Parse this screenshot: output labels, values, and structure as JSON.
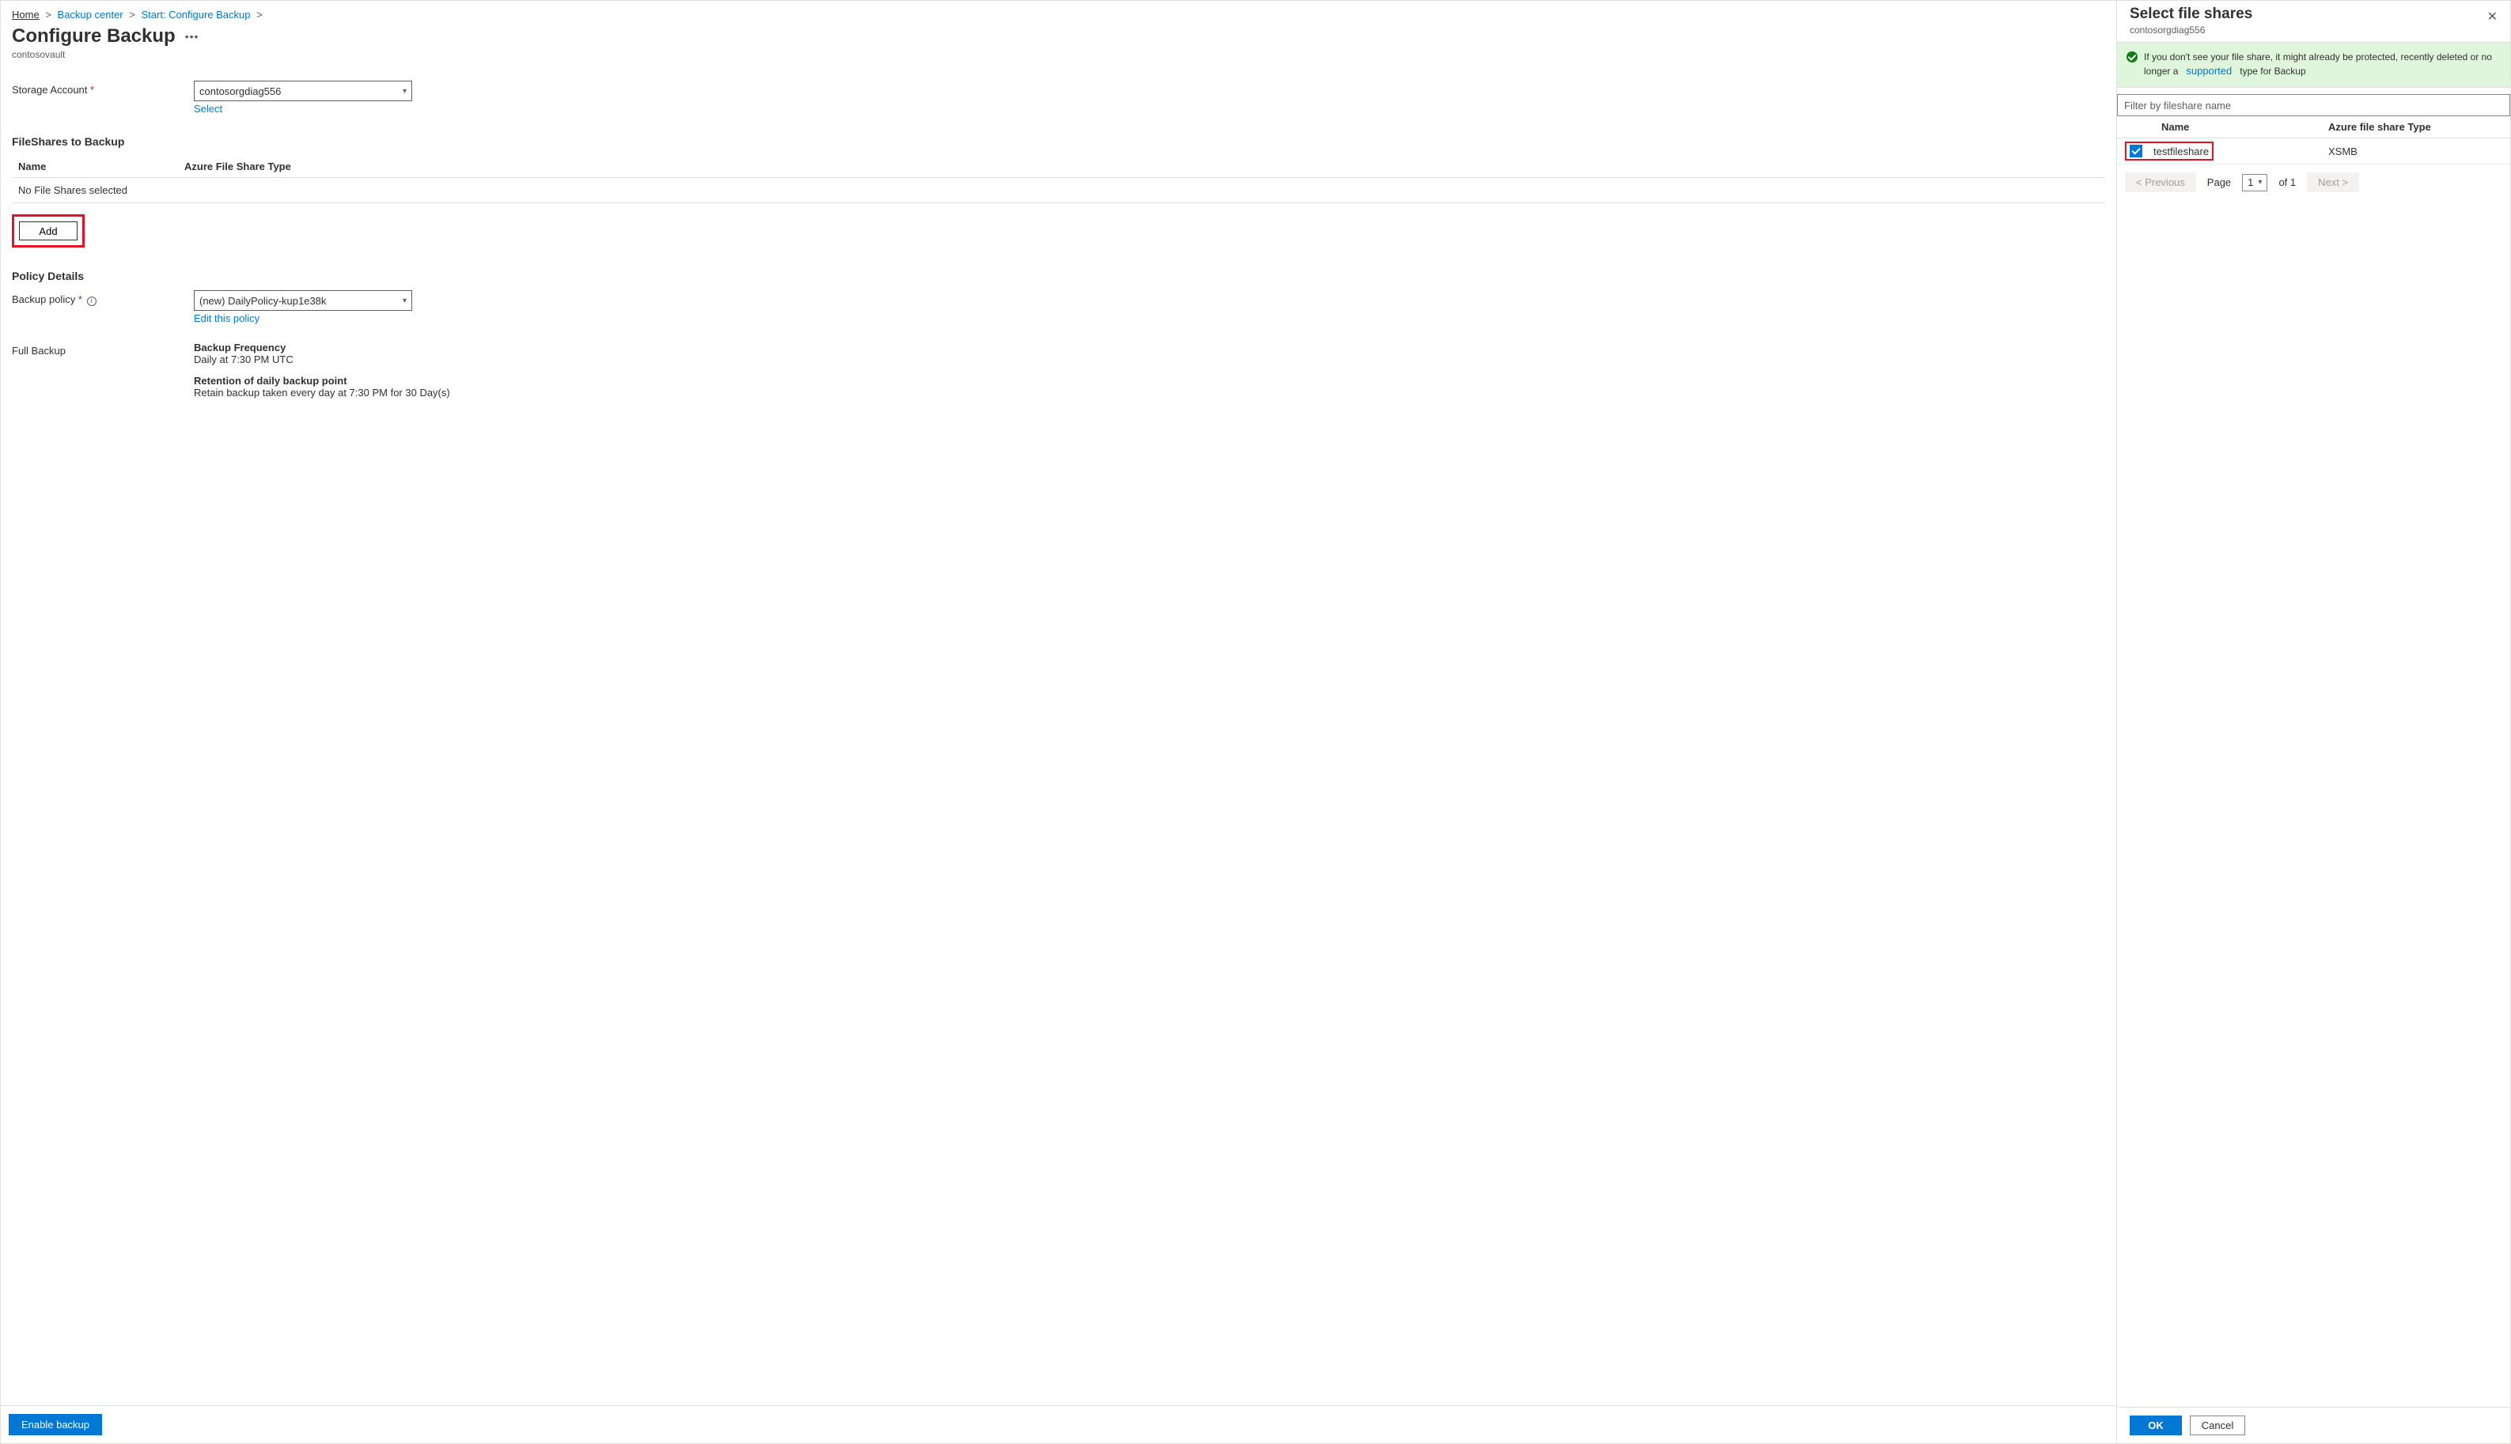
{
  "breadcrumb": {
    "home": "Home",
    "lvl1": "Backup center",
    "lvl2": "Start: Configure Backup"
  },
  "page": {
    "title": "Configure Backup",
    "subtitle": "contosovault"
  },
  "storage": {
    "label": "Storage Account",
    "value": "contosorgdiag556",
    "select_link": "Select"
  },
  "fileshares": {
    "heading": "FileShares to Backup",
    "col_name": "Name",
    "col_type": "Azure File Share Type",
    "empty": "No File Shares selected",
    "add_btn": "Add"
  },
  "policy": {
    "heading": "Policy Details",
    "label": "Backup policy",
    "value": "(new) DailyPolicy-kup1e38k",
    "edit_link": "Edit this policy",
    "full_backup_label": "Full Backup",
    "freq_label": "Backup Frequency",
    "freq_value": "Daily at 7:30 PM UTC",
    "retention_label": "Retention of daily backup point",
    "retention_value": "Retain backup taken every day at 7:30 PM for 30 Day(s)"
  },
  "footer": {
    "enable": "Enable backup"
  },
  "side": {
    "title": "Select file shares",
    "subtitle": "contosorgdiag556",
    "banner_pre": "If you don't see your file share, it might already be protected, recently deleted or no longer a",
    "banner_link": "supported",
    "banner_post": "type for Backup",
    "filter_placeholder": "Filter by fileshare name",
    "col_name": "Name",
    "col_type": "Azure file share Type",
    "row_name": "testfileshare",
    "row_type": "XSMB",
    "prev": "<  Previous",
    "page_label": "Page",
    "page_val": "1",
    "of_label": "of 1",
    "next": "Next  >",
    "ok": "OK",
    "cancel": "Cancel"
  }
}
